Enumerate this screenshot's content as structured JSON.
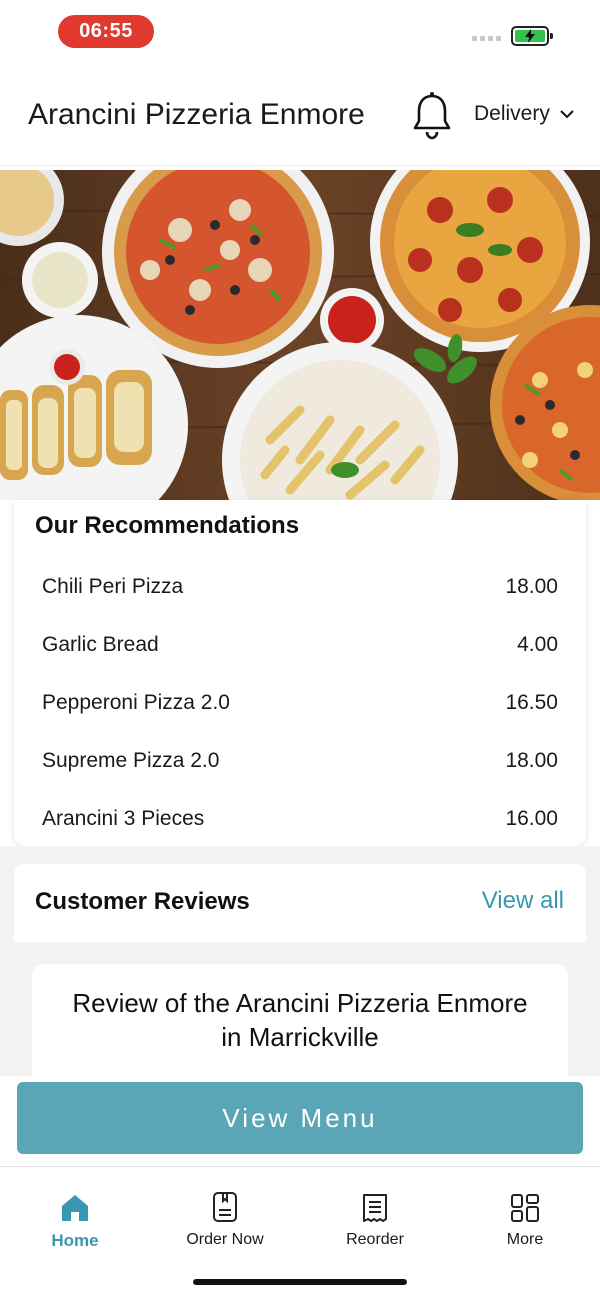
{
  "status_bar": {
    "time": "06:55",
    "battery_icon": "battery-charging-icon",
    "signal_icon": "signal-icon"
  },
  "header": {
    "title": "Arancini Pizzeria Enmore",
    "notification_icon": "bell-icon",
    "mode_label": "Delivery",
    "mode_icon": "chevron-down-icon"
  },
  "hero": {
    "image": "food-banner-image"
  },
  "recommendations": {
    "title": "Our Recommendations",
    "items": [
      {
        "name": "Chili Peri Pizza",
        "price": "18.00"
      },
      {
        "name": "Garlic Bread",
        "price": "4.00"
      },
      {
        "name": "Pepperoni Pizza 2.0",
        "price": "16.50"
      },
      {
        "name": "Supreme Pizza 2.0",
        "price": "18.00"
      },
      {
        "name": "Arancini 3 Pieces",
        "price": "16.00"
      }
    ]
  },
  "reviews": {
    "title": "Customer Reviews",
    "view_all_label": "View all",
    "review_heading": "Review of the Arancini Pizzeria Enmore in Marrickville"
  },
  "view_menu_label": "View Menu",
  "tab_bar": {
    "tabs": [
      {
        "label": "Home",
        "icon": "home-icon",
        "active": true
      },
      {
        "label": "Order Now",
        "icon": "order-icon",
        "active": false
      },
      {
        "label": "Reorder",
        "icon": "receipt-icon",
        "active": false
      },
      {
        "label": "More",
        "icon": "grid-icon",
        "active": false
      }
    ]
  },
  "colors": {
    "accent": "#3a97b4",
    "button": "#5aa5b6",
    "time_pill": "#e0392f",
    "battery": "#33c24d"
  }
}
